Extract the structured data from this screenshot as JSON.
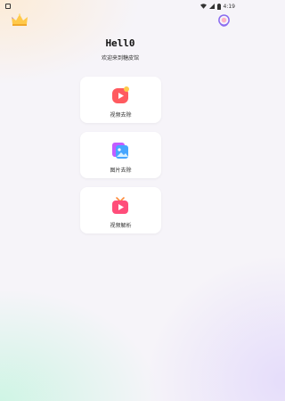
{
  "status_bar": {
    "time": "4:19",
    "icons": [
      "notification-square-icon",
      "wifi-icon",
      "signal-icon",
      "battery-icon"
    ]
  },
  "header": {
    "title": "Hell0",
    "subtitle": "欢迎来到糖皮馆"
  },
  "cards": [
    {
      "label": "视频去除",
      "icon": "video-remove-icon",
      "color": "#ff5a5f"
    },
    {
      "label": "图片去除",
      "icon": "image-remove-icon",
      "color": "#a66bff"
    },
    {
      "label": "视频解析",
      "icon": "video-parse-icon",
      "color": "#ff4d7a"
    }
  ],
  "colors": {
    "accent_orange": "#ffb238",
    "accent_purple": "#8b6cf0",
    "accent_red": "#ff5a5f"
  }
}
